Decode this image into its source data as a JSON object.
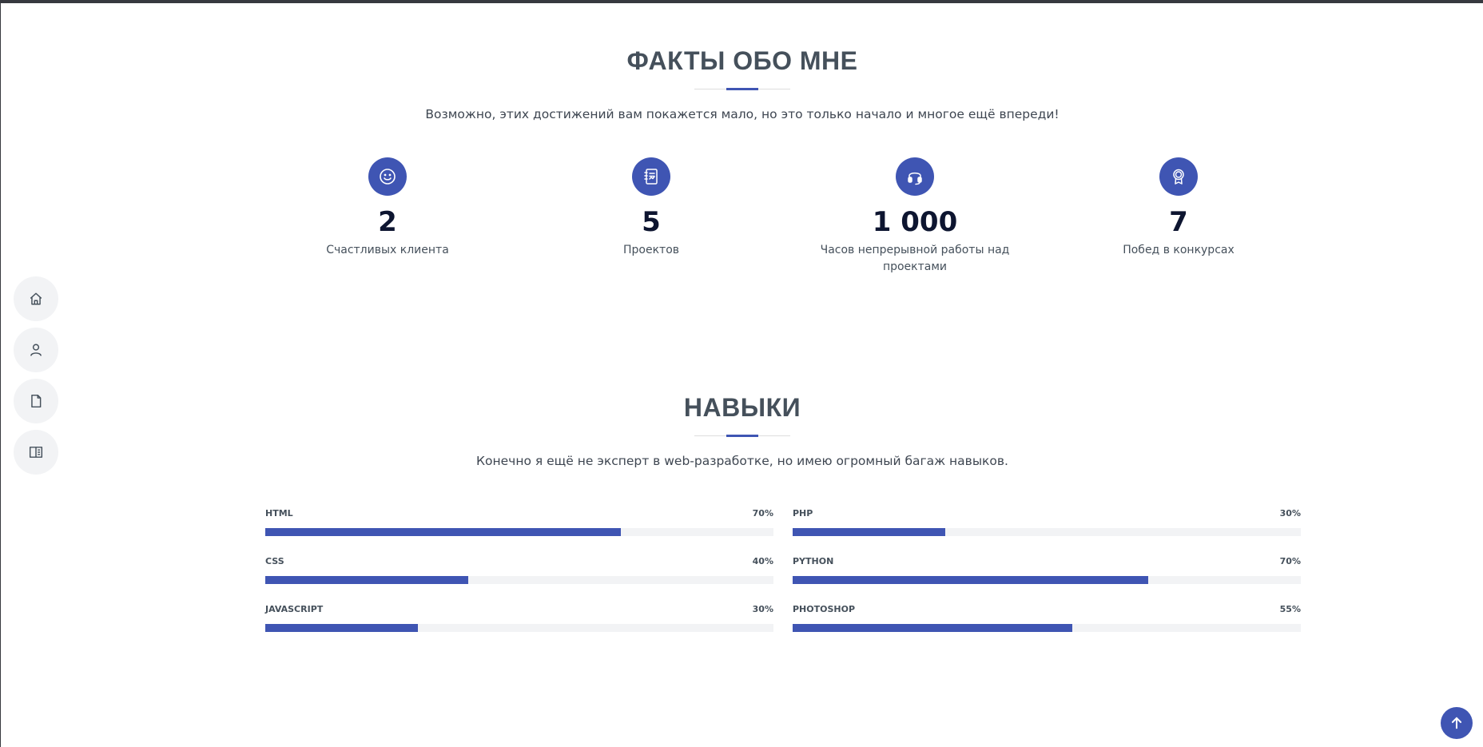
{
  "nav": {
    "items": [
      {
        "icon": "home-icon"
      },
      {
        "icon": "user-icon"
      },
      {
        "icon": "file-icon"
      },
      {
        "icon": "book-icon"
      }
    ]
  },
  "facts": {
    "title": "ФАКТЫ ОБО МНЕ",
    "subtitle": "Возможно, этих достижений вам покажется мало, но это только начало и многое ещё впереди!",
    "items": [
      {
        "icon": "smile-icon",
        "number": "2",
        "label": "Счастливых клиента"
      },
      {
        "icon": "journal-icon",
        "number": "5",
        "label": "Проектов"
      },
      {
        "icon": "headset-icon",
        "number": "1 000",
        "label": "Часов непрерывной работы над проектами"
      },
      {
        "icon": "award-icon",
        "number": "7",
        "label": "Побед в конкурсах"
      }
    ]
  },
  "skills": {
    "title": "НАВЫКИ",
    "subtitle": "Конечно я ещё не эксперт в web-разработке, но имею огромный багаж навыков.",
    "items": [
      {
        "name": "HTML",
        "percent_label": "70%",
        "percent": 70
      },
      {
        "name": "PHP",
        "percent_label": "30%",
        "percent": 30
      },
      {
        "name": "CSS",
        "percent_label": "40%",
        "percent": 40
      },
      {
        "name": "PYTHON",
        "percent_label": "70%",
        "percent": 70
      },
      {
        "name": "JAVASCRIPT",
        "percent_label": "30%",
        "percent": 30
      },
      {
        "name": "PHOTOSHOP",
        "percent_label": "55%",
        "percent": 55
      }
    ]
  },
  "back_to_top": {
    "icon": "arrow-up-icon"
  },
  "colors": {
    "accent": "#3f55b3",
    "heading": "#45505b",
    "track": "#f2f3f5"
  }
}
